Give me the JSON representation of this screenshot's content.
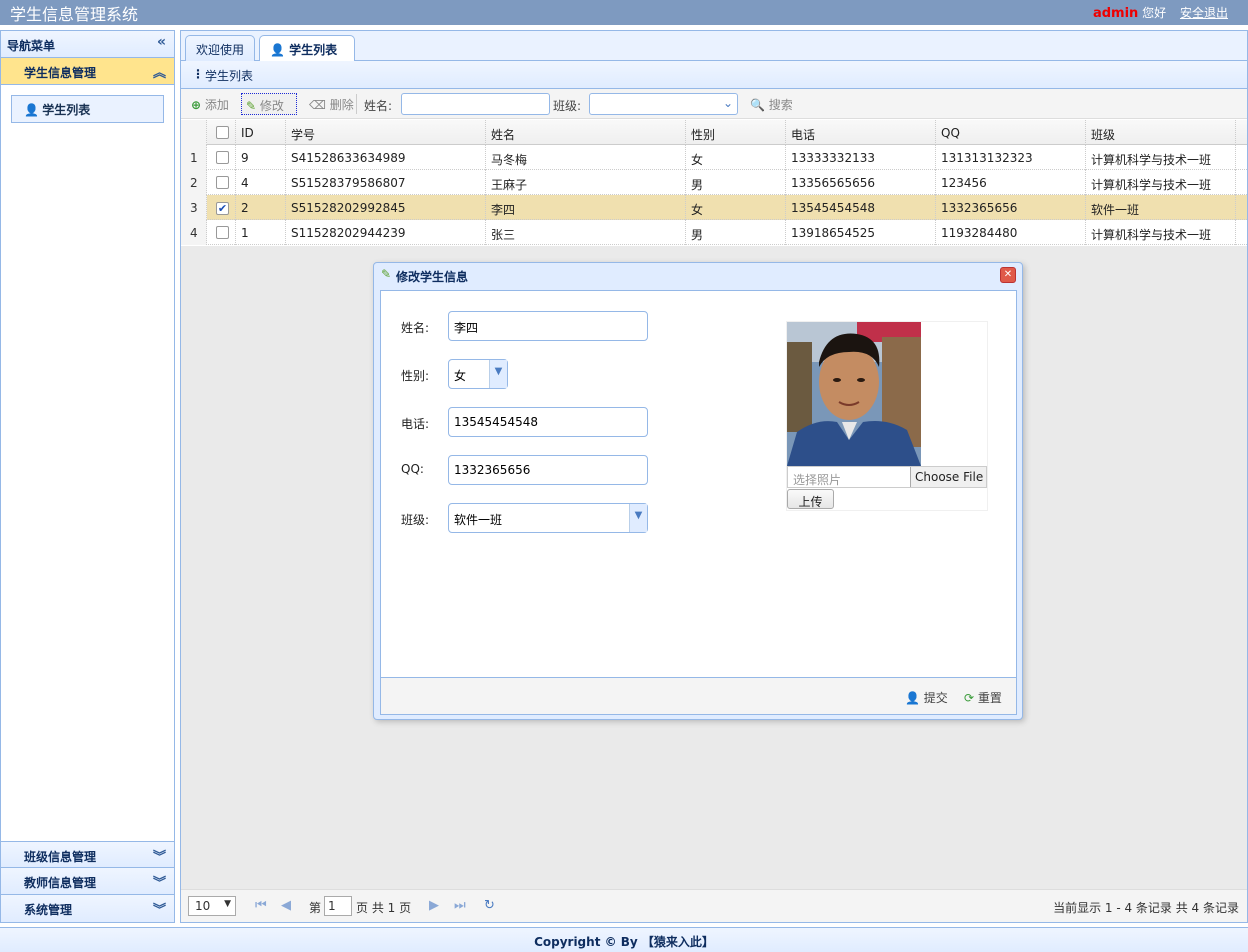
{
  "header": {
    "app_title": "学生信息管理系统",
    "username": "admin",
    "greeting": "您好",
    "logout": "安全退出"
  },
  "sidebar": {
    "title": "导航菜单",
    "active_section": "学生信息管理",
    "active_item": "学生列表",
    "sections": [
      "班级信息管理",
      "教师信息管理",
      "系统管理"
    ]
  },
  "tabs": [
    {
      "label": "欢迎使用"
    },
    {
      "label": "学生列表",
      "close": "×"
    }
  ],
  "panel": {
    "title": "学生列表"
  },
  "toolbar": {
    "add": "添加",
    "edit": "修改",
    "delete": "删除",
    "name_label": "姓名:",
    "class_label": "班级:",
    "search": "搜索",
    "name_value": "",
    "class_value": ""
  },
  "grid": {
    "columns": [
      "",
      "ID",
      "学号",
      "姓名",
      "性别",
      "电话",
      "QQ",
      "班级"
    ],
    "rows": [
      {
        "rn": "1",
        "checked": false,
        "id": "9",
        "sn": "S41528633634989",
        "name": "马冬梅",
        "sex": "女",
        "phone": "13333332133",
        "qq": "131313132323",
        "clazz": "计算机科学与技术一班"
      },
      {
        "rn": "2",
        "checked": false,
        "id": "4",
        "sn": "S51528379586807",
        "name": "王麻子",
        "sex": "男",
        "phone": "13356565656",
        "qq": "123456",
        "clazz": "计算机科学与技术一班"
      },
      {
        "rn": "3",
        "checked": true,
        "id": "2",
        "sn": "S51528202992845",
        "name": "李四",
        "sex": "女",
        "phone": "13545454548",
        "qq": "1332365656",
        "clazz": "软件一班"
      },
      {
        "rn": "4",
        "checked": false,
        "id": "1",
        "sn": "S11528202944239",
        "name": "张三",
        "sex": "男",
        "phone": "13918654525",
        "qq": "1193284480",
        "clazz": "计算机科学与技术一班"
      }
    ]
  },
  "pager": {
    "page_size": "10",
    "page_prefix": "第",
    "page": "1",
    "page_suffix": "页 共 1 页",
    "info": "当前显示 1 - 4 条记录 共 4 条记录"
  },
  "dialog": {
    "title": "修改学生信息",
    "fields": {
      "name_label": "姓名:",
      "name": "李四",
      "sex_label": "性别:",
      "sex": "女",
      "phone_label": "电话:",
      "phone": "13545454548",
      "qq_label": "QQ:",
      "qq": "1332365656",
      "class_label": "班级:",
      "clazz": "软件一班"
    },
    "photo_placeholder": "选择照片",
    "choose_file": "Choose File",
    "upload": "上传",
    "submit": "提交",
    "reset": "重置"
  },
  "footer": {
    "copyright": "Copyright © By 【猿来入此】"
  }
}
